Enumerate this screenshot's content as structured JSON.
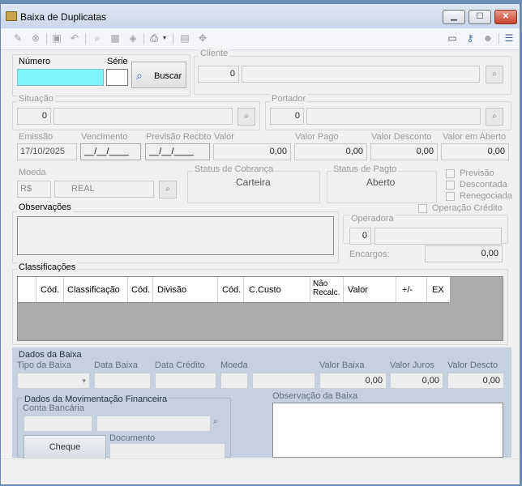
{
  "window": {
    "title": "Baixa de Duplicatas",
    "min": "▁",
    "max": "☐",
    "close": "✕"
  },
  "toolbar": {
    "icons": [
      "edit-icon",
      "cancel-icon",
      "save-icon",
      "undo-icon",
      "zoom-icon",
      "grid-icon",
      "eraser-icon",
      "print-icon",
      "dropdown-icon",
      "doc-icon",
      "move-icon",
      "window-icon",
      "key-icon",
      "user-icon",
      "menu-icon"
    ]
  },
  "search": {
    "numero_label": "Número",
    "serie_label": "Série",
    "numero_value": "",
    "serie_value": "",
    "buscar_label": "Buscar"
  },
  "cliente": {
    "title": "Cliente",
    "code": "0",
    "name": ""
  },
  "situacao": {
    "title": "Situação",
    "code": "0",
    "name": ""
  },
  "portador": {
    "title": "Portador",
    "code": "0",
    "name": ""
  },
  "dates": {
    "emissao_label": "Emissão",
    "emissao_value": "17/10/2025",
    "vencimento_label": "Vencimento",
    "vencimento_value": "__/__/____",
    "previsao_label": "Previsão Recbto",
    "previsao_value": "__/__/____",
    "valor_label": "Valor",
    "valor_value": "0,00",
    "valor_pago_label": "Valor Pago",
    "valor_pago_value": "0,00",
    "valor_desconto_label": "Valor Desconto",
    "valor_desconto_value": "0,00",
    "valor_aberto_label": "Valor em Aberto",
    "valor_aberto_value": "0,00"
  },
  "moeda": {
    "title": "Moeda",
    "symbol": "R$",
    "name": "REAL"
  },
  "status_cobranca": {
    "title": "Status de Cobrança",
    "value": "Carteira"
  },
  "status_pagto": {
    "title": "Status de Pagto",
    "value": "Aberto"
  },
  "flags": {
    "previsao": "Previsão",
    "descontada": "Descontada",
    "renegociada": "Renegociada",
    "operacao_credito": "Operação Crédito"
  },
  "observacoes": {
    "title": "Observações",
    "value": ""
  },
  "operadora": {
    "title": "Operadora",
    "code": "0",
    "name": "",
    "encargos_label": "Encargos:",
    "encargos_value": "0,00"
  },
  "classificacoes": {
    "title": "Classificações",
    "headers": [
      "",
      "Cód.",
      "Classificação",
      "Cód.",
      "Divisão",
      "Cód.",
      "C.Custo",
      "Não Recalc.",
      "Valor",
      "+/-",
      "EX"
    ]
  },
  "baixa": {
    "title": "Dados da Baixa",
    "tipo_label": "Tipo da Baixa",
    "tipo_value": "",
    "data_baixa_label": "Data Baixa",
    "data_credito_label": "Data Crédito",
    "moeda_label": "Moeda",
    "valor_baixa_label": "Valor Baixa",
    "valor_baixa_value": "0,00",
    "valor_juros_label": "Valor Juros",
    "valor_juros_value": "0,00",
    "valor_descto_label": "Valor Descto",
    "valor_descto_value": "0,00",
    "mov_title": "Dados da Movimentação Financeira",
    "conta_label": "Conta Bancária",
    "documento_label": "Documento",
    "cheque_label": "Cheque",
    "obs_label": "Observação da Baixa"
  }
}
